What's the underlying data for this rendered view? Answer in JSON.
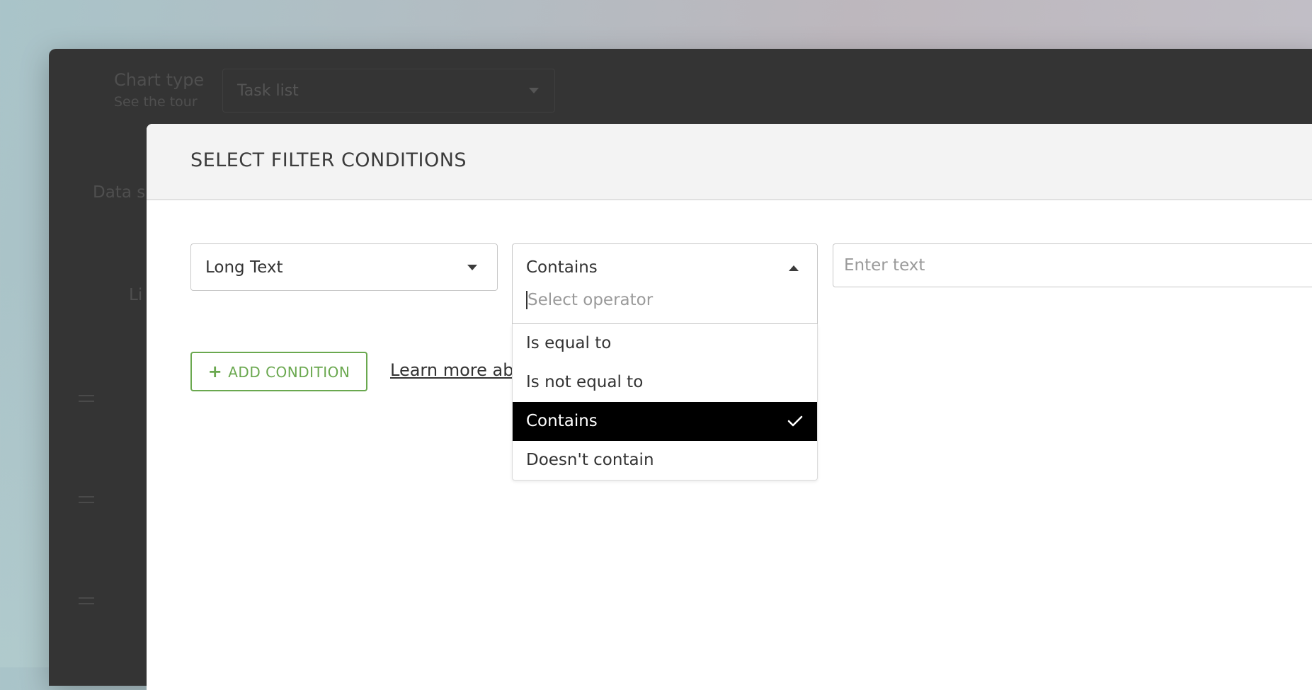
{
  "background_app": {
    "chart_type_label": "Chart type",
    "chart_type_sub": "See the tour",
    "chart_type_value": "Task list",
    "data_label": "Data s",
    "list_label": "Li"
  },
  "modal": {
    "title": "SELECT FILTER CONDITIONS",
    "field_select": {
      "value": "Long Text"
    },
    "operator_dropdown": {
      "value": "Contains",
      "search_placeholder": "Select operator",
      "options": [
        {
          "label": "Is equal to",
          "selected": false
        },
        {
          "label": "Is not equal to",
          "selected": false
        },
        {
          "label": "Contains",
          "selected": true
        },
        {
          "label": "Doesn't contain",
          "selected": false
        }
      ]
    },
    "text_input": {
      "placeholder": "Enter text",
      "value": ""
    },
    "add_condition_label": "ADD CONDITION",
    "learn_more_label": "Learn more abo"
  },
  "colors": {
    "accent_green": "#6aa84f",
    "selected_bg": "#000000",
    "overlay": "#343434"
  }
}
